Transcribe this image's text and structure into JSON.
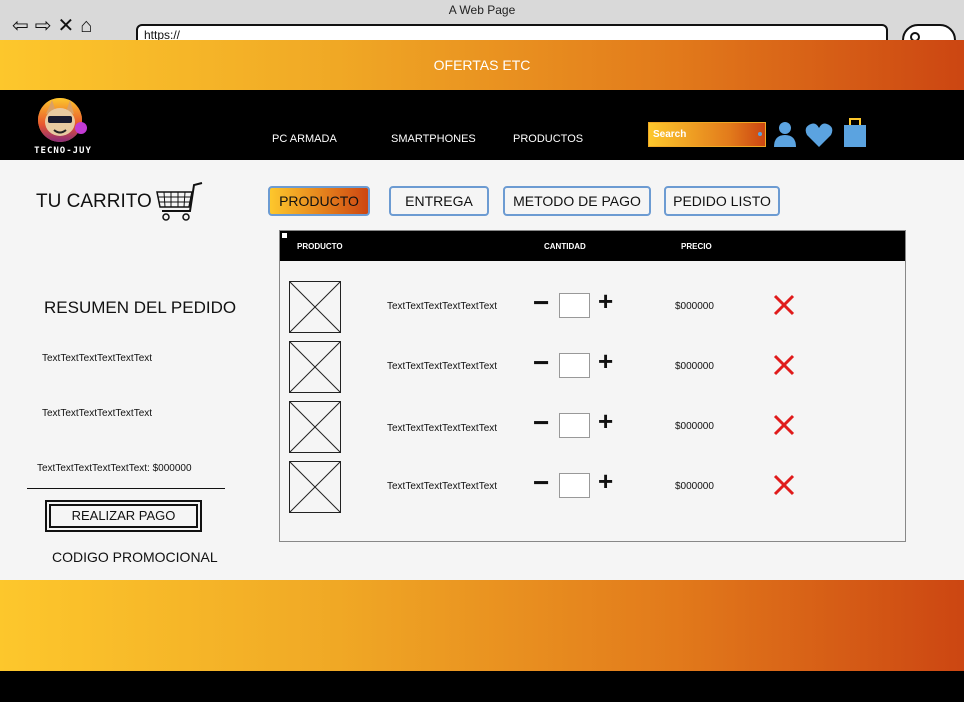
{
  "browser": {
    "window_title": "A Web Page",
    "url": "https://"
  },
  "offers_bar": {
    "text": "OFERTAS ETC"
  },
  "brand": {
    "logo_text": "TECNO-JUY"
  },
  "nav": {
    "links": [
      "PC ARMADA",
      "SMARTPHONES",
      "PRODUCTOS"
    ],
    "search_placeholder": "Search"
  },
  "cart": {
    "title": "TU CARRITO",
    "steps": [
      {
        "label": "PRODUCTO",
        "active": true
      },
      {
        "label": "ENTREGA",
        "active": false
      },
      {
        "label": "METODO DE PAGO",
        "active": false
      },
      {
        "label": "PEDIDO LISTO",
        "active": false
      }
    ]
  },
  "table": {
    "headers": {
      "product": "PRODUCTO",
      "quantity": "CANTIDAD",
      "price": "PRECIO"
    },
    "rows": [
      {
        "name": "TextTextTextTextTextText",
        "price": "$000000"
      },
      {
        "name": "TextTextTextTextTextText",
        "price": "$000000"
      },
      {
        "name": "TextTextTextTextTextText",
        "price": "$000000"
      },
      {
        "name": "TextTextTextTextTextText",
        "price": "$000000"
      }
    ],
    "minus_symbol": "−",
    "plus_symbol": "+"
  },
  "summary": {
    "title": "RESUMEN DEL PEDIDO",
    "line1": "TextTextTextTextTextText",
    "line2": "TextTextTextTextTextText",
    "total": "TextTextTextTextTextText: $000000",
    "pay_button": "REALIZAR PAGO",
    "promo": "CODIGO PROMOCIONAL"
  },
  "colors": {
    "accent_start": "#fdc72c",
    "accent_end": "#cc4612",
    "icon_blue": "#5ba3e0",
    "remove_red": "#e01b1b"
  },
  "icons": {
    "user": "user-icon",
    "heart": "heart-icon",
    "bag": "shopping-bag-icon",
    "cart": "shopping-cart-icon",
    "remove": "close-x-icon"
  }
}
